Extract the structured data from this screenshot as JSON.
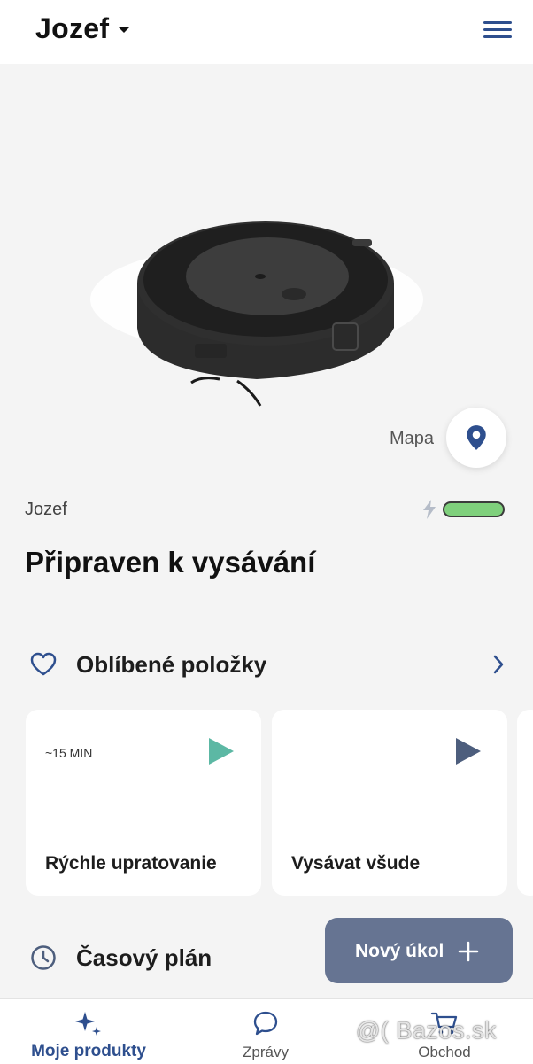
{
  "header": {
    "device_name": "Jozef"
  },
  "hero": {
    "map_label": "Mapa"
  },
  "status": {
    "robot_name": "Jozef",
    "state_text": "Připraven k vysávání",
    "battery_level": 1.0
  },
  "favorites": {
    "title": "Oblíbené položky",
    "cards": [
      {
        "duration": "~15 MIN",
        "title": "Rýchle upratovanie",
        "play_color": "#5cb8a4"
      },
      {
        "duration": "",
        "title": "Vysávat všude",
        "play_color": "#4d5e7d"
      }
    ]
  },
  "schedule": {
    "title": "Časový plán"
  },
  "fab": {
    "label": "Nový úkol"
  },
  "nav": {
    "home": "Moje produkty",
    "messages": "Zprávy",
    "shop": "Obchod"
  },
  "colors": {
    "accent": "#2e4f8e",
    "fab": "#667492",
    "battery": "#7fd07c"
  },
  "watermark": "@( Bazos.sk"
}
